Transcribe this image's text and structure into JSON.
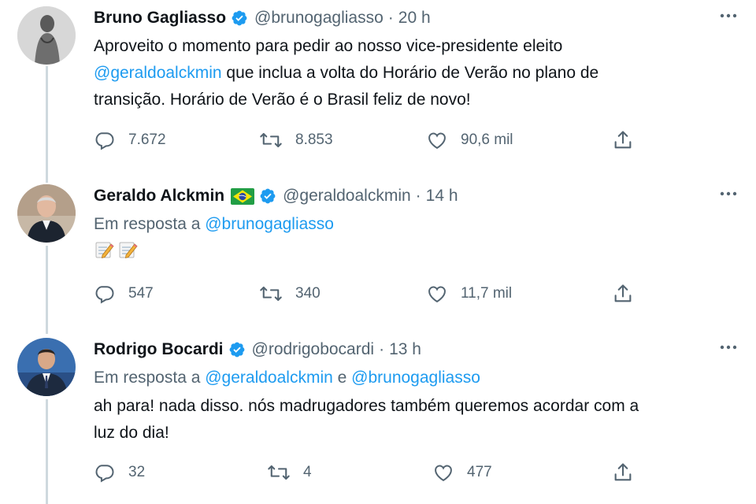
{
  "tweets": [
    {
      "name": "Bruno Gagliasso",
      "handle": "@brunogagliasso",
      "separator": "·",
      "time": "20 h",
      "text_parts": {
        "p1": "Aproveito o momento para pedir ao nosso vice-presidente eleito",
        "mention": "@geraldoalckmin",
        "p2": " que inclua a volta do Horário de Verão no plano de",
        "p3": "transição. Horário de Verão é o Brasil feliz de novo!"
      },
      "stats": {
        "replies": "7.672",
        "retweets": "8.853",
        "likes": "90,6 mil"
      }
    },
    {
      "name": "Geraldo Alckmin",
      "flag": "brazil-flag",
      "handle": "@geraldoalckmin",
      "separator": "·",
      "time": "14 h",
      "reply_prefix": "Em resposta a ",
      "reply_to": "@brunogagliasso",
      "emojis": [
        "memo-emoji",
        "memo-emoji"
      ],
      "stats": {
        "replies": "547",
        "retweets": "340",
        "likes": "11,7 mil"
      }
    },
    {
      "name": "Rodrigo Bocardi",
      "handle": "@rodrigobocardi",
      "separator": "·",
      "time": "13 h",
      "reply_prefix": "Em resposta a ",
      "reply_to_1": "@geraldoalckmin",
      "reply_joiner": " e ",
      "reply_to_2": "@brunogagliasso",
      "text_line1": "ah para! nada disso. nós madrugadores também queremos acordar com a",
      "text_line2": "luz do dia!",
      "stats": {
        "replies": "32",
        "retweets": "4",
        "likes": "477"
      }
    }
  ],
  "icons": [
    "verified-badge-icon",
    "more-icon",
    "reply-icon",
    "retweet-icon",
    "like-icon",
    "share-icon"
  ],
  "colors": {
    "accent": "#1d9bf0",
    "text": "#0f1419",
    "muted": "#536471",
    "thread_line": "#cfd9de"
  }
}
